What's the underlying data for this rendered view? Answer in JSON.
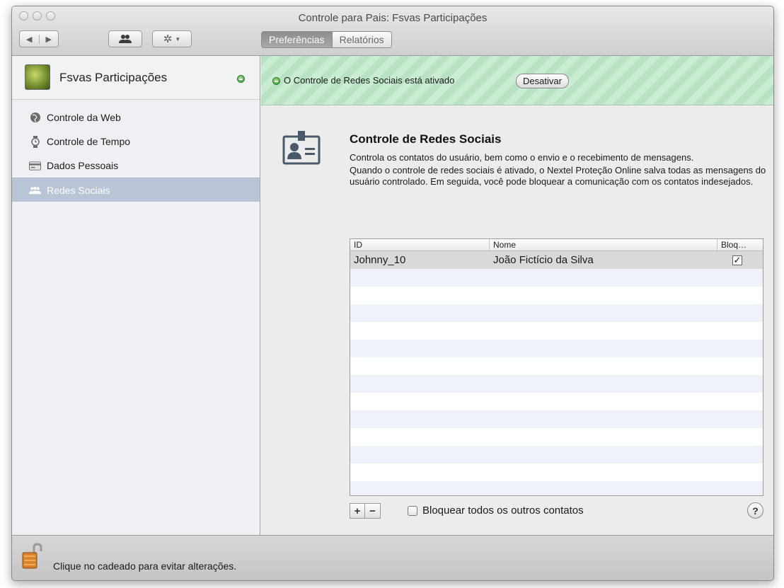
{
  "window": {
    "title": "Controle para Pais: Fsvas Participações"
  },
  "toolbar": {
    "back_icon": "back-arrow-icon",
    "forward_icon": "forward-arrow-icon",
    "users_icon": "users-icon",
    "gear_icon": "gear-icon",
    "tabs": [
      {
        "label": "Preferências",
        "active": true
      },
      {
        "label": "Relatórios",
        "active": false
      }
    ]
  },
  "sidebar": {
    "profile": {
      "name": "Fsvas Participações",
      "status": "active"
    },
    "items": [
      {
        "label": "Controle da Web",
        "icon": "globe-icon",
        "selected": false
      },
      {
        "label": "Controle de Tempo",
        "icon": "watch-icon",
        "selected": false
      },
      {
        "label": "Dados Pessoais",
        "icon": "card-icon",
        "selected": false
      },
      {
        "label": "Redes Sociais",
        "icon": "people-icon",
        "selected": true
      }
    ]
  },
  "banner": {
    "status_text": "O Controle de Redes Sociais está ativado",
    "button_label": "Desativar",
    "color": "#c3e8cc"
  },
  "section": {
    "icon": "contact-badge-icon",
    "title": "Controle de Redes Sociais",
    "description_1": "Controla os contatos do usuário, bem como o envio e o recebimento de mensagens.",
    "description_2": "Quando o controle de redes sociais é ativado, o Nextel Proteção Online salva todas as mensagens do usuário controlado. Em seguida, você pode bloquear a comunicação com os contatos indesejados."
  },
  "table": {
    "columns": [
      "ID",
      "Nome",
      "Bloq…"
    ],
    "rows": [
      {
        "id": "Johnny_10",
        "name": "João Fictício da Silva",
        "blocked": true
      }
    ]
  },
  "bottom": {
    "add_label": "+",
    "remove_label": "−",
    "block_all_label": "Bloquear todos os outros contatos",
    "help_label": "?"
  },
  "footer": {
    "lock_icon": "padlock-icon",
    "text": "Clique no cadeado para evitar alterações."
  }
}
